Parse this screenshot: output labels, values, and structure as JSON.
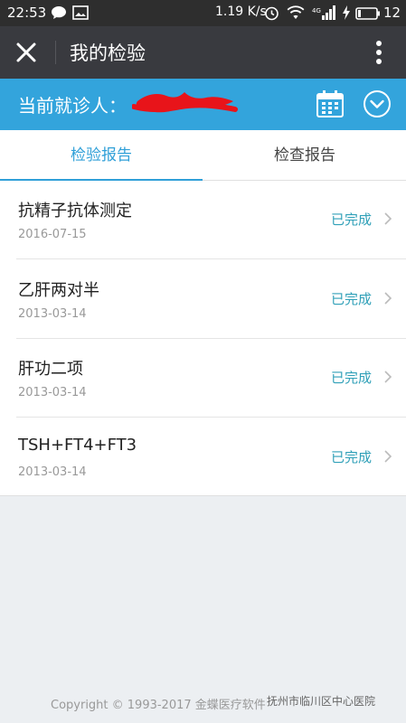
{
  "status_bar": {
    "time": "22:53",
    "network_speed": "1.19 K/s",
    "battery_level": "12"
  },
  "title_bar": {
    "title": "我的检验"
  },
  "patient_bar": {
    "label": "当前就诊人："
  },
  "tabs": [
    {
      "label": "检验报告",
      "active": true
    },
    {
      "label": "检查报告",
      "active": false
    }
  ],
  "reports": [
    {
      "name": "抗精子抗体测定",
      "date": "2016-07-15",
      "status": "已完成"
    },
    {
      "name": "乙肝两对半",
      "date": "2013-03-14",
      "status": "已完成"
    },
    {
      "name": "肝功二项",
      "date": "2013-03-14",
      "status": "已完成"
    },
    {
      "name": "TSH+FT4+FT3",
      "date": "2013-03-14",
      "status": "已完成"
    }
  ],
  "footer": {
    "copyright": "Copyright © 1993-2017 金蝶医疗软件"
  },
  "watermark": "抚州市临川区中心医院",
  "colors": {
    "accent": "#33a4dc",
    "title_bar_bg": "#393a3f",
    "status_bar_bg": "#2e2e2e",
    "status_text": "#30a0b8",
    "background": "#eceff2"
  },
  "icons": {
    "close": "close-icon",
    "more": "more-vertical-icon",
    "calendar": "calendar-icon",
    "dropdown": "chevron-down-circle-icon",
    "row_arrow": "chevron-right-icon"
  }
}
